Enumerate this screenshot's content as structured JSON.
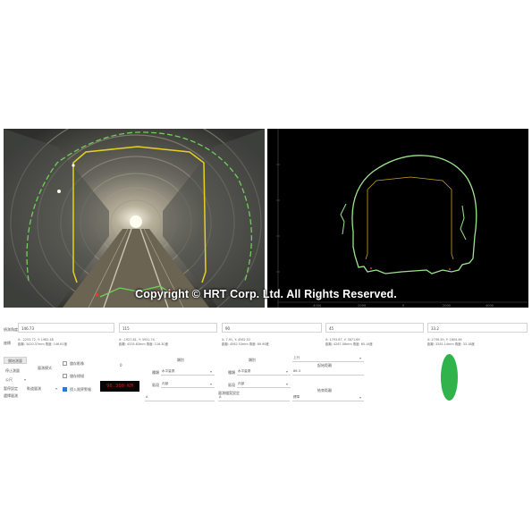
{
  "panels": {
    "watermark": "Copyright © HRT Corp. Ltd. All Rights Reserved.",
    "scan_axis_ticks": [
      "-4000",
      "-2000",
      "0",
      "2000",
      "4000"
    ]
  },
  "form": {
    "label_measure": "偵測角度",
    "label_coord": "座標",
    "columns": [
      {
        "value": "146.73",
        "coord_line1": "X: -2253.72, Y: 1982.48",
        "coord_line2": "距離: 3420.37mm 角度: 146.61度"
      },
      {
        "value": "115",
        "coord_line1": "X: -1927.81, Y: 3931.74",
        "coord_line2": "距離: 4335.83mm 角度: 116.30度"
      },
      {
        "value": "90",
        "coord_line1": "X: 7.91, Y: 4562.52",
        "coord_line2": "距離: 4562.53mm 角度: 89.90度"
      },
      {
        "value": "45",
        "coord_line1": "X: 1793.87, Y: 3871.69",
        "coord_line2": "距離: 4267.08mm 角度: 65.14度"
      },
      {
        "value": "33.2",
        "coord_line1": "X: 2739.59, Y: 1804.46",
        "coord_line2": "距離: 3281.14mm 角度: 33.18度"
      }
    ],
    "btn_start": "開始測量",
    "btn_stop": "停止測量",
    "label_mode": "量測模式",
    "label_unit": "公尺",
    "label_pause": "暫停設定",
    "mode_option": "軌道量測",
    "chk_save_image": "儲存影像",
    "chk_save_scan": "儲存掃描",
    "chk_alarm": "侵入限界警報",
    "label_select": "選擇量測",
    "zero_label": "0",
    "km_display": "96.300 KM",
    "type_label_1": "種類",
    "type_value_1": "水平量測",
    "region_label_1": "區段",
    "region_value_1": "內部",
    "dropdown_label_a": "類別",
    "dropdown_value_a": "A",
    "type_label_2": "種類",
    "type_value_2": "水平量測",
    "region_label_2": "區段",
    "region_value_2": "內部",
    "dropdown_label_b": "類別",
    "dropdown_value_b": "A",
    "right_label_1": "上行",
    "right_label_2": "起始距離",
    "right_value_2": "86.3",
    "right_label_3": "結束距離",
    "right_label_4": "距離",
    "right_value_4": "標準",
    "bottom_label": "量測檔案設定"
  },
  "colors": {
    "status": "#2fb34a",
    "gauge_outline": "#e6d21c",
    "scan_green": "#9de38f",
    "km_text": "#e01818"
  }
}
